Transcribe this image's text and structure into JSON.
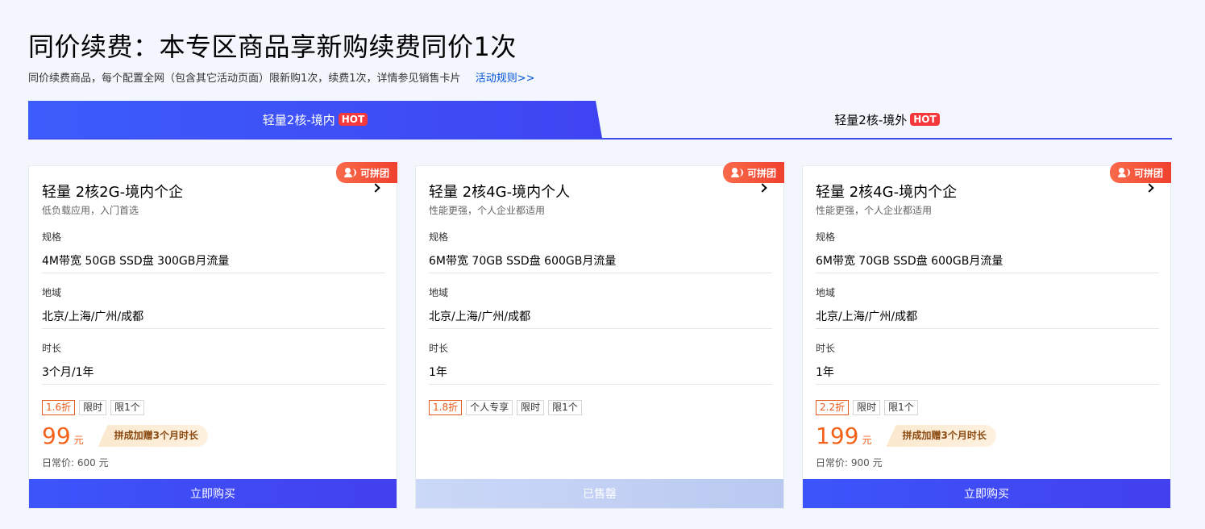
{
  "header": {
    "title": "同价续费：本专区商品享新购续费同价1次",
    "subtitle": "同价续费商品，每个配置全网（包含其它活动页面）限新购1次，续费1次，详情参见销售卡片",
    "rules_link": "活动规则>>"
  },
  "tabs": [
    {
      "label": "轻量2核-境内",
      "hot": "HOT",
      "active": true
    },
    {
      "label": "轻量2核-境外",
      "hot": "HOT",
      "active": false
    }
  ],
  "colors": {
    "accent": "#3d4bf0",
    "price": "#f4621a",
    "hot": "#f5383b",
    "badge": "#f0412e"
  },
  "labels": {
    "spec": "规格",
    "region": "地域",
    "duration": "时长",
    "badge": "可拼团",
    "unit": "元"
  },
  "cards": [
    {
      "name": "轻量 2核2G-境内个企",
      "desc": "低负载应用，入门首选",
      "spec": "4M带宽 50GB SSD盘 300GB月流量",
      "region": "北京/上海/广州/成都",
      "duration": "3个月/1年",
      "tags": [
        "1.6折",
        "限时",
        "限1个"
      ],
      "price": "99",
      "gift": "拼成加赠3个月时长",
      "original": "日常价: 600 元",
      "button": "立即购买"
    },
    {
      "name": "轻量 2核4G-境内个人",
      "desc": "性能更强，个人企业都适用",
      "spec": "6M带宽 70GB SSD盘 600GB月流量",
      "region": "北京/上海/广州/成都",
      "duration": "1年",
      "tags": [
        "1.8折",
        "个人专享",
        "限时",
        "限1个"
      ],
      "button": "已售罄"
    },
    {
      "name": "轻量 2核4G-境内个企",
      "desc": "性能更强，个人企业都适用",
      "spec": "6M带宽 70GB SSD盘 600GB月流量",
      "region": "北京/上海/广州/成都",
      "duration": "1年",
      "tags": [
        "2.2折",
        "限时",
        "限1个"
      ],
      "price": "199",
      "gift": "拼成加赠3个月时长",
      "original": "日常价: 900 元",
      "button": "立即购买"
    }
  ]
}
